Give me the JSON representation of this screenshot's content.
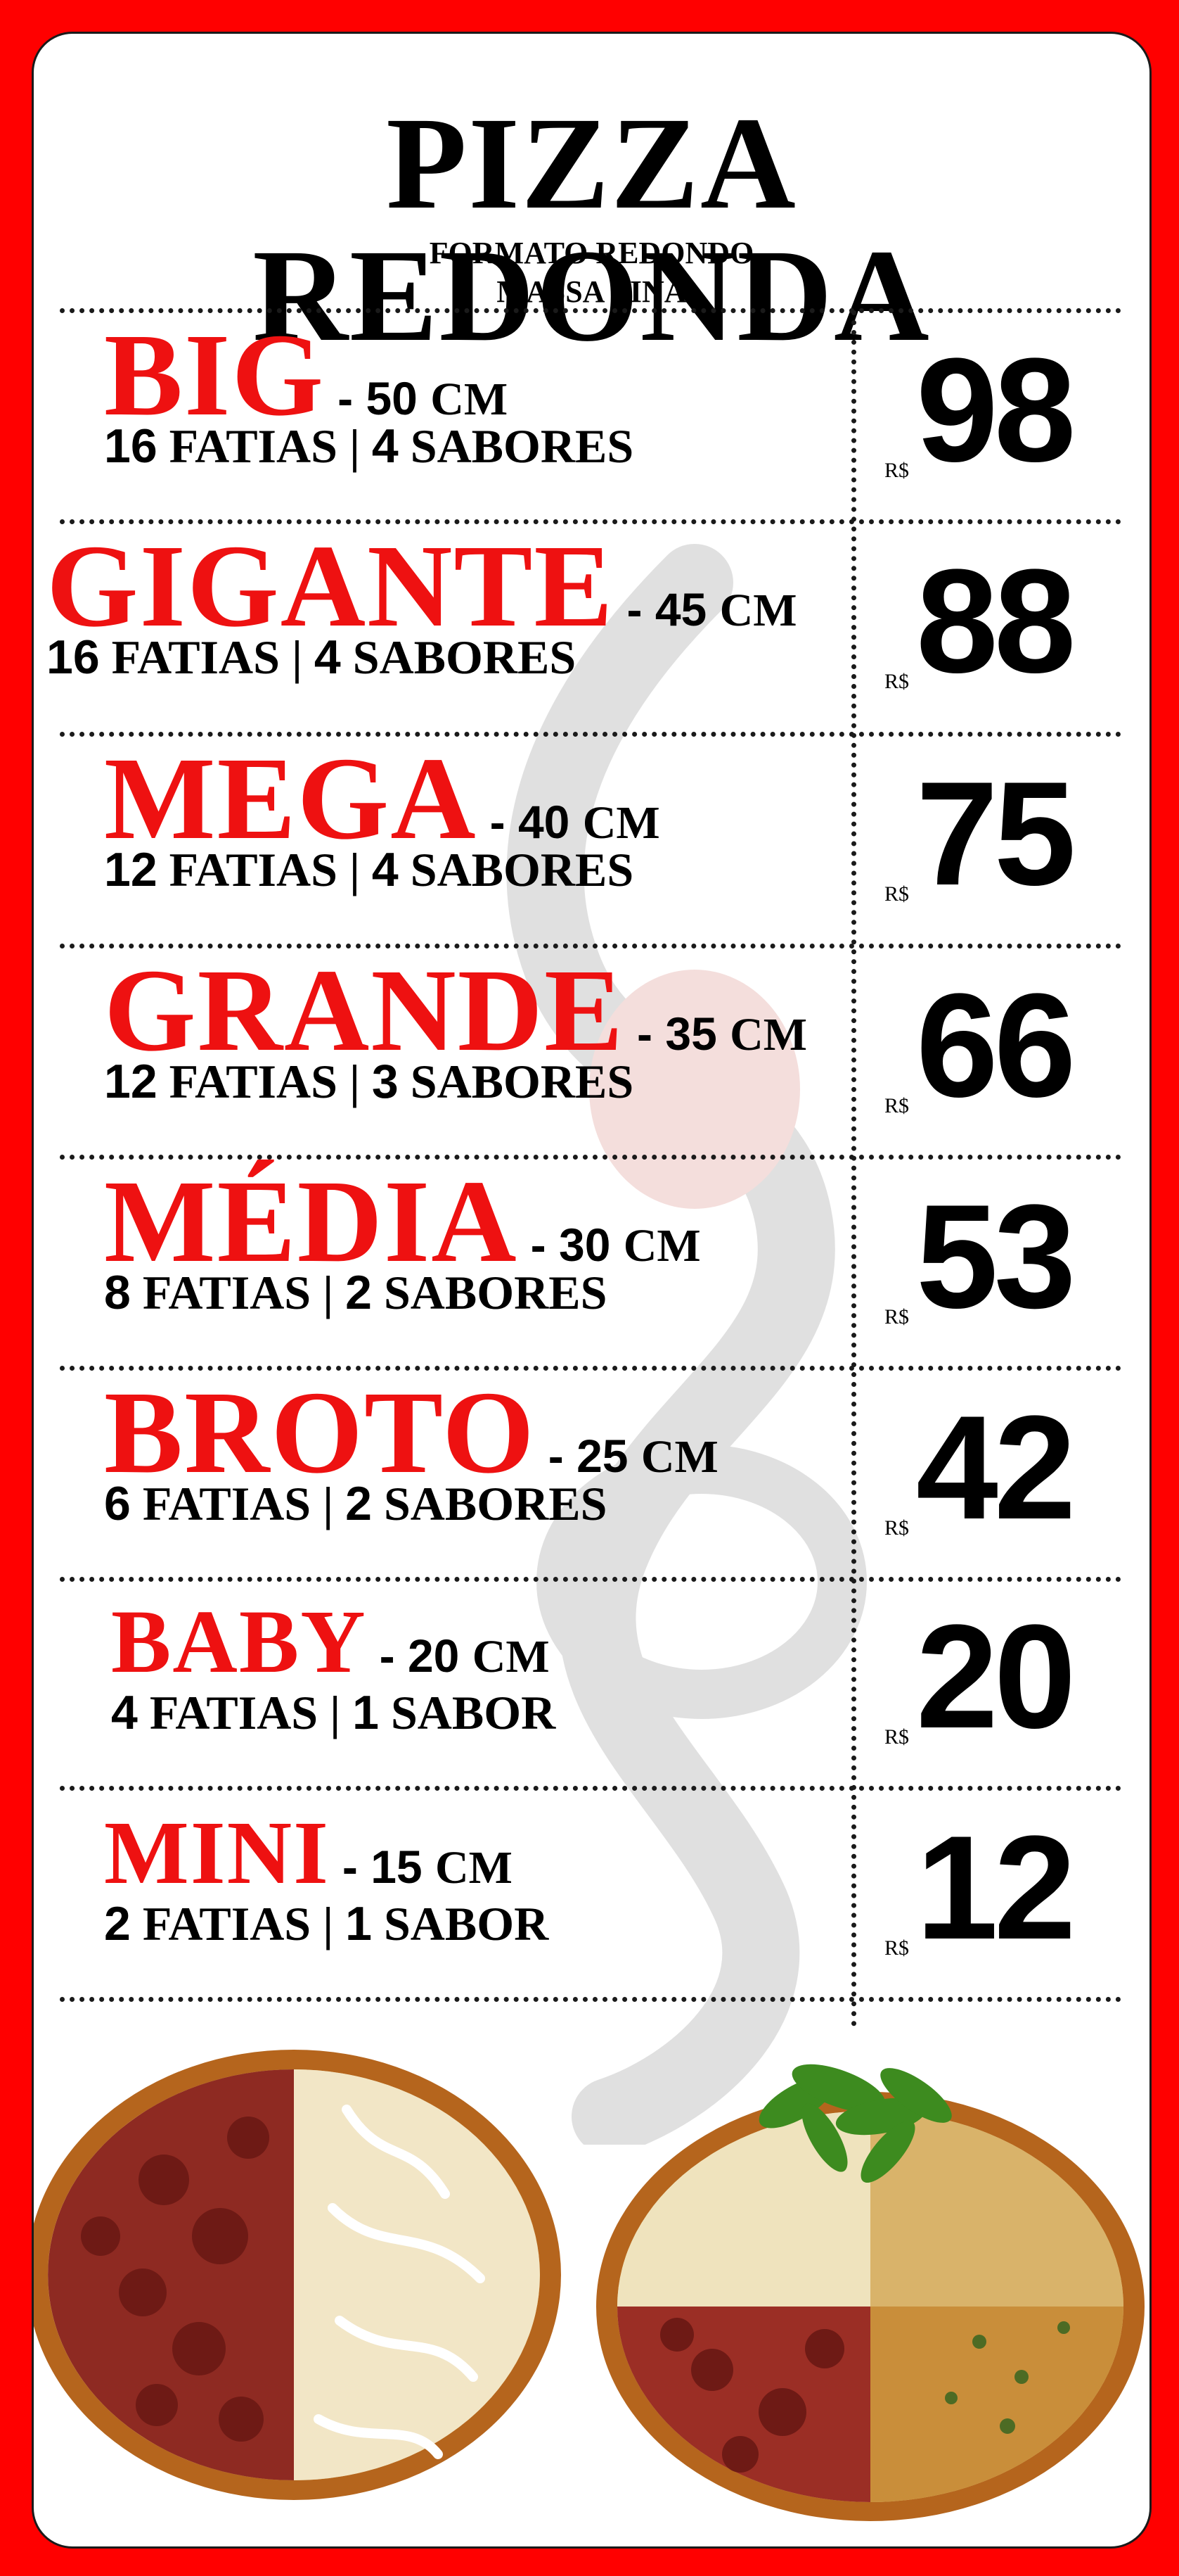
{
  "header": {
    "title": "PIZZA REDONDA",
    "subtitle_1": "FORMATO REDONDO",
    "subtitle_2": "MASSA FINA"
  },
  "currency": "R$",
  "colors": {
    "background": "#ff0000",
    "accent": "#ee1111",
    "text": "#000000"
  },
  "sizes": [
    {
      "name": "BIG",
      "dim_num": "50",
      "dim_unit": "CM",
      "slices_num": "16",
      "slices_label": "FATIAS",
      "flavors_num": "4",
      "flavors_label": "SABORES",
      "price": "98"
    },
    {
      "name": "GIGANTE",
      "dim_num": "45",
      "dim_unit": "CM",
      "slices_num": "16",
      "slices_label": "FATIAS",
      "flavors_num": "4",
      "flavors_label": "SABORES",
      "price": "88"
    },
    {
      "name": "MEGA",
      "dim_num": "40",
      "dim_unit": "CM",
      "slices_num": "12",
      "slices_label": "FATIAS",
      "flavors_num": "4",
      "flavors_label": "SABORES",
      "price": "75"
    },
    {
      "name": "GRANDE",
      "dim_num": "35",
      "dim_unit": "CM",
      "slices_num": "12",
      "slices_label": "FATIAS",
      "flavors_num": "3",
      "flavors_label": "SABORES",
      "price": "66"
    },
    {
      "name": "MÉDIA",
      "dim_num": "30",
      "dim_unit": "CM",
      "slices_num": "8",
      "slices_label": "FATIAS",
      "flavors_num": "2",
      "flavors_label": "SABORES",
      "price": "53"
    },
    {
      "name": "BROTO",
      "dim_num": "25",
      "dim_unit": "CM",
      "slices_num": "6",
      "slices_label": "FATIAS",
      "flavors_num": "2",
      "flavors_label": "SABORES",
      "price": "42"
    },
    {
      "name": "BABY",
      "dim_num": "20",
      "dim_unit": "CM",
      "slices_num": "4",
      "slices_label": "FATIAS",
      "flavors_num": "1",
      "flavors_label": "SABOR",
      "price": "20"
    },
    {
      "name": "MINI",
      "dim_num": "15",
      "dim_unit": "CM",
      "slices_num": "2",
      "slices_label": "FATIAS",
      "flavors_num": "1",
      "flavors_label": "SABOR",
      "price": "12"
    }
  ],
  "images": [
    {
      "icon": "pizza-calabresa-catupiry-image"
    },
    {
      "icon": "pizza-four-flavors-arugula-image"
    }
  ]
}
